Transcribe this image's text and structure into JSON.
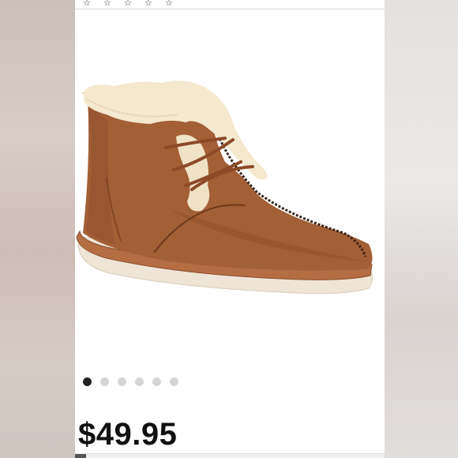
{
  "listing": {
    "rating_icons": [
      "star-icon",
      "star-icon",
      "star-icon",
      "star-icon",
      "star-icon"
    ],
    "image_alt": "",
    "carousel": {
      "count": 6,
      "active_index": 0
    },
    "price": "$49.95"
  },
  "colors": {
    "suede": "#a35f36",
    "fur": "#f3e6cc",
    "sole": "#eee3d3",
    "dot_active": "#222222",
    "dot_inactive": "#d5d5d5"
  }
}
